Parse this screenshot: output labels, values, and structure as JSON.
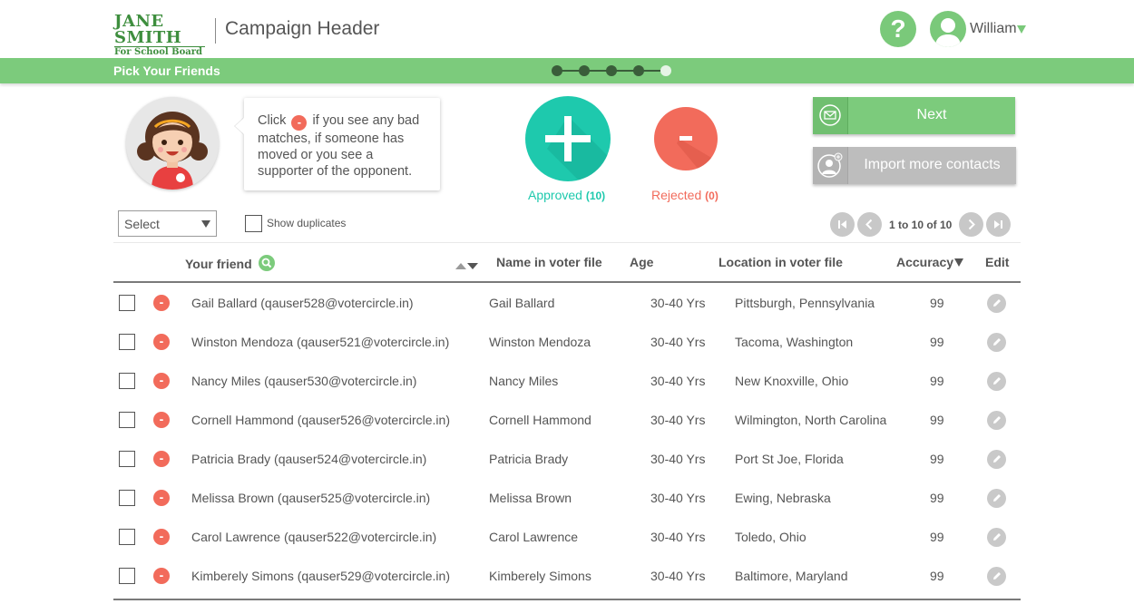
{
  "header": {
    "logo_top": "JANE SMITH",
    "logo_bottom": "For School Board",
    "campaign_title": "Campaign Header",
    "help_label": "?",
    "user_name": "William"
  },
  "stepbar": {
    "title": "Pick Your Friends",
    "steps_total": 5,
    "step_current": 5
  },
  "bubble": {
    "pre": "Click",
    "post": "if you see any bad matches, if someone has moved or you see a supporter of the opponent."
  },
  "actions": {
    "approved_label": "Approved",
    "approved_count": "(10)",
    "rejected_label": "Rejected",
    "rejected_count": "(0)",
    "next_label": "Next",
    "import_label": "Import more contacts"
  },
  "filters": {
    "select_value": "Select",
    "show_duplicates_label": "Show duplicates"
  },
  "pager": {
    "text": "1 to 10 of 10"
  },
  "table": {
    "columns": {
      "friend": "Your friend",
      "voter_name": "Name in voter file",
      "age": "Age",
      "location": "Location in voter file",
      "accuracy": "Accuracy",
      "edit": "Edit"
    },
    "rows": [
      {
        "friend": "Gail Ballard (qauser528@votercircle.in)",
        "voter_name": "Gail Ballard",
        "age": "30-40 Yrs",
        "location": "Pittsburgh, Pennsylvania",
        "accuracy": "99"
      },
      {
        "friend": "Winston Mendoza (qauser521@votercircle.in)",
        "voter_name": "Winston Mendoza",
        "age": "30-40 Yrs",
        "location": "Tacoma, Washington",
        "accuracy": "99"
      },
      {
        "friend": "Nancy Miles (qauser530@votercircle.in)",
        "voter_name": "Nancy Miles",
        "age": "30-40 Yrs",
        "location": "New Knoxville, Ohio",
        "accuracy": "99"
      },
      {
        "friend": "Cornell Hammond (qauser526@votercircle.in)",
        "voter_name": "Cornell Hammond",
        "age": "30-40 Yrs",
        "location": "Wilmington, North Carolina",
        "accuracy": "99"
      },
      {
        "friend": "Patricia Brady (qauser524@votercircle.in)",
        "voter_name": "Patricia Brady",
        "age": "30-40 Yrs",
        "location": "Port St Joe, Florida",
        "accuracy": "99"
      },
      {
        "friend": "Melissa Brown (qauser525@votercircle.in)",
        "voter_name": "Melissa Brown",
        "age": "30-40 Yrs",
        "location": "Ewing, Nebraska",
        "accuracy": "99"
      },
      {
        "friend": "Carol Lawrence (qauser522@votercircle.in)",
        "voter_name": "Carol Lawrence",
        "age": "30-40 Yrs",
        "location": "Toledo, Ohio",
        "accuracy": "99"
      },
      {
        "friend": "Kimberely Simons (qauser529@votercircle.in)",
        "voter_name": "Kimberely Simons",
        "age": "30-40 Yrs",
        "location": "Baltimore, Maryland",
        "accuracy": "99"
      }
    ]
  },
  "colors": {
    "brand_green": "#7ccb7c",
    "approve_teal": "#1ec9ad",
    "reject_red": "#f26b5b",
    "step_dark": "#3a5d3a"
  },
  "icons": {
    "help": "question-icon",
    "avatar": "user-avatar-icon",
    "approve": "plus-icon",
    "reject": "minus-icon",
    "next": "envelope-icon",
    "import": "add-contact-icon",
    "search": "search-icon",
    "edit": "pencil-icon",
    "pager_first": "skip-first-icon",
    "pager_prev": "chevron-left-icon",
    "pager_next": "chevron-right-icon",
    "pager_last": "skip-last-icon"
  }
}
